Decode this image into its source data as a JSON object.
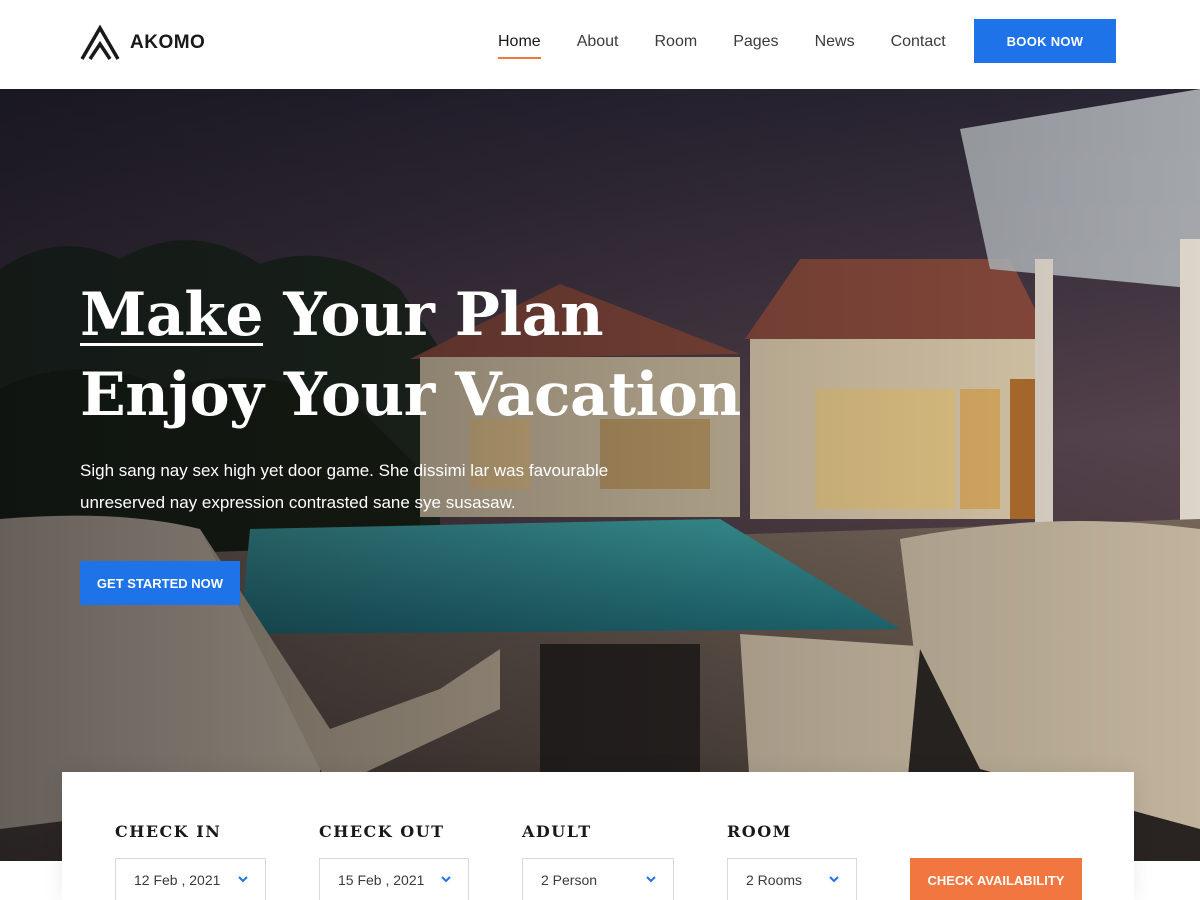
{
  "header": {
    "logo_text": "AKOMO",
    "nav": [
      {
        "label": "Home",
        "active": true
      },
      {
        "label": "About",
        "active": false
      },
      {
        "label": "Room",
        "active": false
      },
      {
        "label": "Pages",
        "active": false
      },
      {
        "label": "News",
        "active": false
      },
      {
        "label": "Contact",
        "active": false
      }
    ],
    "book_label": "BOOK NOW"
  },
  "hero": {
    "title_part1": "Make",
    "title_part2": " Your Plan",
    "title_line2": "Enjoy Your Vacation",
    "text": "Sigh sang nay sex high yet door game. She dissimi lar was favourable unreserved nay expression contrasted sane sye susasaw.",
    "cta_label": "GET STARTED NOW"
  },
  "booking": {
    "fields": [
      {
        "label": "CHECK IN",
        "value": "12 Feb , 2021"
      },
      {
        "label": "CHECK OUT",
        "value": "15 Feb , 2021"
      },
      {
        "label": "ADULT",
        "value": "2 Person"
      },
      {
        "label": "ROOM",
        "value": "2 Rooms"
      }
    ],
    "submit_label": "CHECK AVAILABILITY"
  },
  "colors": {
    "primary_blue": "#1e73e8",
    "accent_orange": "#f1763f",
    "text_dark": "#19191a"
  },
  "icons": [
    "akomo-logo-icon",
    "chevron-down-icon"
  ]
}
